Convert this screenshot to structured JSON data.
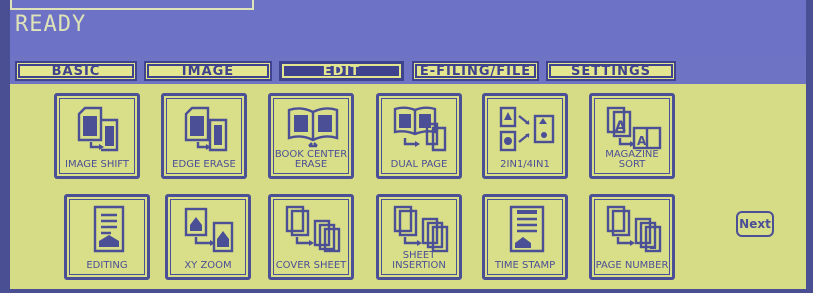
{
  "status": {
    "text": "READY"
  },
  "tabs": [
    {
      "label": "BASIC"
    },
    {
      "label": "IMAGE"
    },
    {
      "label": "EDIT",
      "active": true
    },
    {
      "label": "E-FILING/FILE"
    },
    {
      "label": "SETTINGS"
    }
  ],
  "functions": [
    {
      "label": "IMAGE SHIFT",
      "icon": "image-shift-icon"
    },
    {
      "label": "EDGE ERASE",
      "icon": "edge-erase-icon"
    },
    {
      "label": "BOOK CENTER\nERASE",
      "icon": "book-center-erase-icon"
    },
    {
      "label": "DUAL PAGE",
      "icon": "dual-page-icon"
    },
    {
      "label": "2IN1/4IN1",
      "icon": "2in1-4in1-icon"
    },
    {
      "label": "MAGAZINE SORT",
      "icon": "magazine-sort-icon"
    },
    {
      "label": "EDITING",
      "icon": "editing-icon"
    },
    {
      "label": "XY ZOOM",
      "icon": "xy-zoom-icon"
    },
    {
      "label": "COVER SHEET",
      "icon": "cover-sheet-icon"
    },
    {
      "label": "SHEET\nINSERTION",
      "icon": "sheet-insertion-icon"
    },
    {
      "label": "TIME STAMP",
      "icon": "time-stamp-icon"
    },
    {
      "label": "PAGE NUMBER",
      "icon": "page-number-icon"
    }
  ],
  "next": {
    "label": "Next"
  },
  "colors": {
    "panel": "#d6db86",
    "outline": "#4b4f96",
    "screen": "#7b80cf",
    "tab_active": "#3f438d"
  }
}
